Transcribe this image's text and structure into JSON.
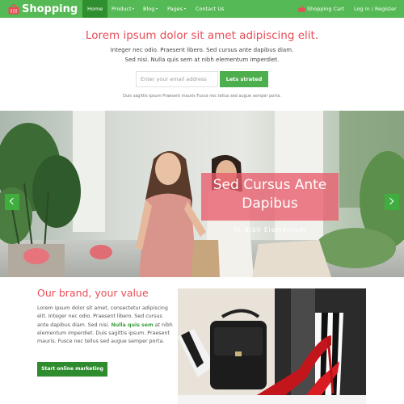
{
  "navbar": {
    "brand": "Shopping",
    "items": [
      {
        "label": "Home",
        "active": true,
        "has_dropdown": false
      },
      {
        "label": "Product",
        "active": false,
        "has_dropdown": true
      },
      {
        "label": "Blog",
        "active": false,
        "has_dropdown": true
      },
      {
        "label": "Pages",
        "active": false,
        "has_dropdown": true
      },
      {
        "label": "Contact Us",
        "active": false,
        "has_dropdown": false
      }
    ],
    "cart_label": "Shopping Cart",
    "auth_label": "Log in / Register",
    "color": "#55b955"
  },
  "hero": {
    "title": "Lorem ipsum dolor sit amet adipiscing elit.",
    "subtitle_line1": "Integer nec odio. Praesent libero. Sed cursus ante dapibus diam.",
    "subtitle_line2": "Sed nisi. Nulla quis sem at nibh elementum imperdiet.",
    "email_placeholder": "Enter your email address",
    "subscribe_label": "Lets strated",
    "note": "Duis sagittis ipsum Praesent mauris Fusce nec tellus sed augue semper porta.",
    "title_color": "#e94d58"
  },
  "slider": {
    "caption_title": "Sed Cursus Ante Dapibus",
    "caption_subtitle": "At Nibh Elementum",
    "prev_icon": "chevron-left-icon",
    "next_icon": "chevron-right-icon",
    "caption_color": "#e85c6c"
  },
  "brand_section": {
    "heading": "Our brand, your value",
    "paragraph_before_link": "Lorem ipsum dolor sit amet, consectetur adipiscing elit. Integer nec odio. Praesent libero. Sed cursus ante dapibus diam. Sed nisi. ",
    "link_text": "Nulla quis sem",
    "paragraph_after_link": " at nibh elementum imperdiet. Duis sagittis ipsum. Praesent mauris. Fusce nec tellus sed augue semper porta.",
    "button_label": "Start online marketing"
  }
}
